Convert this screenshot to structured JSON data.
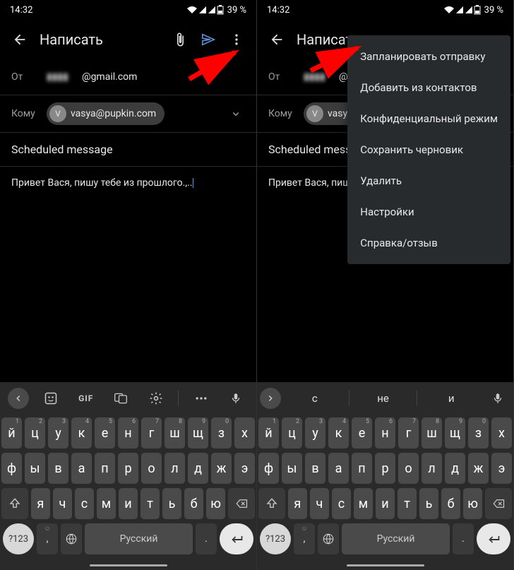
{
  "status": {
    "time": "14:32",
    "battery": "39 %"
  },
  "app": {
    "title": "Написать"
  },
  "compose": {
    "from_label": "От",
    "from_value": "@gmail.com",
    "to_label": "Кому",
    "chip_initial": "V",
    "chip_email": "vasya@pupkin.com",
    "chip_email_short": "vasya@pu",
    "subject": "Scheduled message",
    "subject_short": "Scheduled message",
    "body": "Привет Вася, пишу тебе из прошлого.,..",
    "body_short": "Привет Вася, пишу"
  },
  "menu": {
    "items": [
      "Запланировать отправку",
      "Добавить из контактов",
      "Конфиденциальный режим",
      "Сохранить черновик",
      "Удалить",
      "Настройки",
      "Справка/отзыв"
    ]
  },
  "keyboard": {
    "suggestions": [
      "с",
      "не",
      "и"
    ],
    "row1": [
      "й",
      "ц",
      "у",
      "к",
      "е",
      "н",
      "г",
      "ш",
      "щ",
      "з",
      "х"
    ],
    "hints1": [
      "1",
      "2",
      "3",
      "4",
      "5",
      "6",
      "7",
      "8",
      "9",
      "0",
      ""
    ],
    "row2": [
      "ф",
      "ы",
      "в",
      "а",
      "п",
      "р",
      "о",
      "л",
      "д",
      "ж",
      "э"
    ],
    "row3": [
      "я",
      "ч",
      "с",
      "м",
      "и",
      "т",
      "ь",
      "б",
      "ю"
    ],
    "sym": "?123",
    "lang": "Русский",
    "comma": ",",
    "period": ".",
    "gif": "GIF"
  }
}
